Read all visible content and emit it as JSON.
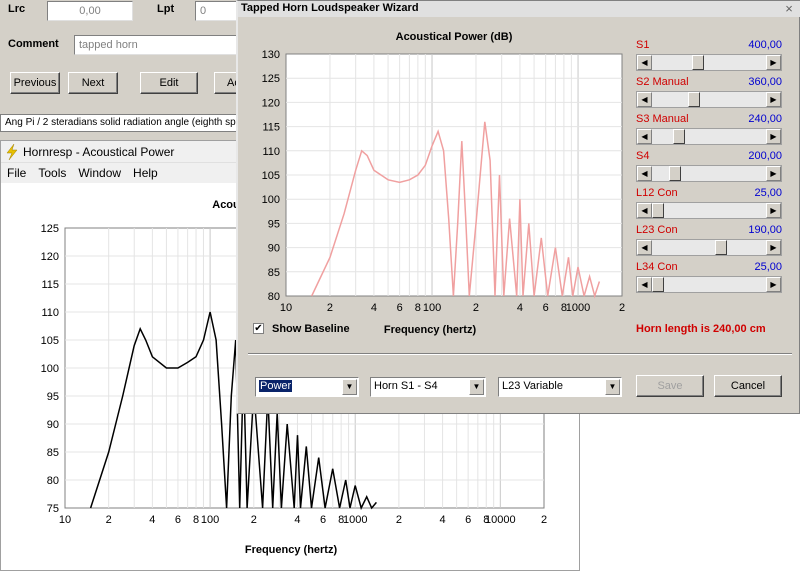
{
  "top_panel": {
    "lrc_label": "Lrc",
    "lrc_value": "0,00",
    "lpt_label": "Lpt",
    "lpt_value": "0",
    "comment_label": "Comment",
    "comment_value": "tapped horn",
    "buttons": {
      "previous": "Previous",
      "next": "Next",
      "edit": "Edit",
      "partial": "Ac"
    },
    "ang_text": "Ang  Pi / 2 steradians solid radiation angle  (eighth sp"
  },
  "hornresp_window": {
    "title": "Hornresp - Acoustical Power",
    "menu": [
      "File",
      "Tools",
      "Window",
      "Help"
    ],
    "chart_title_partial": "Acou"
  },
  "wizard": {
    "title": "Tapped Horn Loudspeaker Wizard",
    "close_glyph": "×",
    "sliders": [
      {
        "name": "S1",
        "value": "400,00",
        "position": 0.39
      },
      {
        "name": "S2  Manual",
        "value": "360,00",
        "position": 0.35
      },
      {
        "name": "S3  Manual",
        "value": "240,00",
        "position": 0.21
      },
      {
        "name": "S4",
        "value": "200,00",
        "position": 0.17
      },
      {
        "name": "L12  Con",
        "value": "25,00",
        "position": 0.0
      },
      {
        "name": "L23  Con",
        "value": "190,00",
        "position": 0.62
      },
      {
        "name": "L34  Con",
        "value": "25,00",
        "position": 0.0
      }
    ],
    "show_baseline_label": "Show Baseline",
    "show_baseline_checked": true,
    "horn_length_text": "Horn length is 240,00 cm",
    "combos": {
      "view": "Power",
      "segment": "Horn S1 - S4",
      "variable": "L23 Variable"
    },
    "save_label": "Save",
    "cancel_label": "Cancel"
  },
  "chart_data": [
    {
      "type": "line",
      "title": "Acoustical Power (dB)",
      "xlabel": "Frequency (hertz)",
      "ylabel": "",
      "xscale": "log",
      "xlim": [
        10,
        2000
      ],
      "ylim": [
        80,
        130
      ],
      "yticks": [
        80,
        85,
        90,
        95,
        100,
        105,
        110,
        115,
        120,
        125,
        130
      ],
      "xtick_labels": [
        "10",
        "2",
        "4",
        "6",
        "8",
        "100",
        "2",
        "4",
        "6",
        "8",
        "1000",
        "2"
      ],
      "grid": true,
      "color": "#f0a0a0",
      "series": [
        {
          "x": [
            15,
            20,
            25,
            30,
            33,
            36,
            40,
            50,
            60,
            70,
            80,
            90,
            100,
            110,
            120,
            130,
            140,
            150,
            160,
            170,
            180,
            200,
            230,
            250,
            270,
            290,
            310,
            340,
            380,
            400,
            420,
            460,
            500,
            560,
            620,
            700,
            780,
            860,
            920,
            1000,
            1100,
            1200,
            1300,
            1400
          ],
          "y": [
            78,
            88,
            97,
            106,
            110,
            109,
            106,
            104,
            103.5,
            104,
            105,
            107,
            111,
            114,
            110,
            96,
            80,
            95,
            112,
            96,
            80,
            95,
            116,
            108,
            80,
            105,
            80,
            96,
            80,
            100,
            80,
            95,
            80,
            92,
            80,
            90,
            80,
            88,
            80,
            86,
            80,
            84,
            80,
            83
          ]
        }
      ]
    },
    {
      "type": "line",
      "title": "Acou",
      "xlabel": "Frequency (hertz)",
      "ylabel": "",
      "xscale": "log",
      "xlim": [
        10,
        20000
      ],
      "ylim": [
        75,
        125
      ],
      "yticks": [
        75,
        80,
        85,
        90,
        95,
        100,
        105,
        110,
        115,
        120,
        125
      ],
      "xtick_labels": [
        "10",
        "2",
        "4",
        "6",
        "8",
        "100",
        "2",
        "4",
        "6",
        "8",
        "1000",
        "2",
        "4",
        "6",
        "8",
        "10000",
        "2"
      ],
      "grid": true,
      "color": "#000000",
      "series": [
        {
          "x": [
            15,
            20,
            25,
            30,
            33,
            36,
            40,
            50,
            60,
            70,
            80,
            90,
            100,
            110,
            120,
            130,
            140,
            150,
            160,
            170,
            180,
            200,
            230,
            250,
            270,
            290,
            310,
            340,
            380,
            400,
            420,
            460,
            500,
            560,
            620,
            700,
            780,
            860,
            920,
            1000,
            1100,
            1200,
            1300,
            1400
          ],
          "y": [
            75,
            85,
            95,
            104,
            107,
            105,
            102,
            100,
            100,
            101,
            102,
            105,
            110,
            105,
            90,
            75,
            95,
            105,
            75,
            100,
            75,
            96,
            75,
            95,
            75,
            92,
            75,
            90,
            75,
            88,
            75,
            86,
            75,
            84,
            75,
            82,
            75,
            80,
            75,
            79,
            75,
            77,
            75,
            76
          ]
        }
      ]
    }
  ]
}
